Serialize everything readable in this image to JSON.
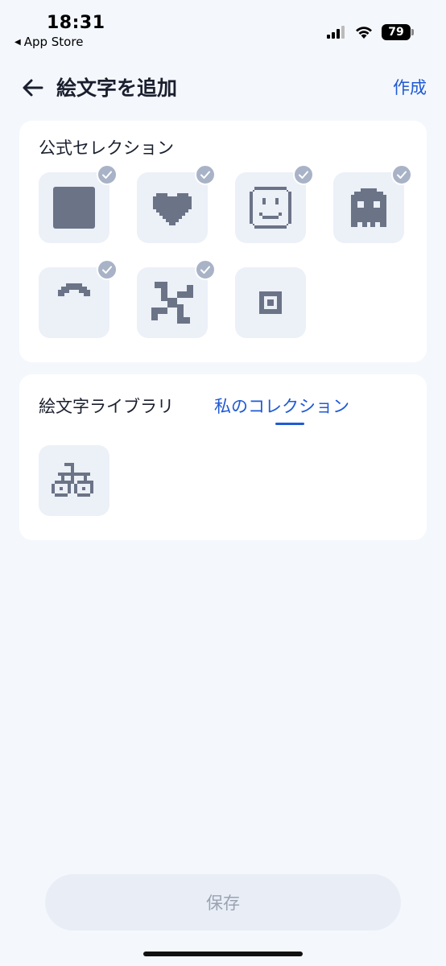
{
  "status_bar": {
    "time": "18:31",
    "back_app": "App Store",
    "battery": "79"
  },
  "header": {
    "title": "絵文字を追加",
    "create_label": "作成"
  },
  "official_selection": {
    "title": "公式セレクション",
    "items": [
      {
        "icon": "square-icon",
        "selected": true
      },
      {
        "icon": "heart-icon",
        "selected": true
      },
      {
        "icon": "smiley-face-icon",
        "selected": true
      },
      {
        "icon": "ghost-icon",
        "selected": true
      },
      {
        "icon": "arch-icon",
        "selected": true
      },
      {
        "icon": "pinwheel-icon",
        "selected": true
      },
      {
        "icon": "concentric-square-icon",
        "selected": false
      }
    ]
  },
  "library": {
    "tabs": [
      {
        "label": "絵文字ライブラリ",
        "active": false
      },
      {
        "label": "私のコレクション",
        "active": true
      }
    ],
    "items": [
      {
        "icon": "bicycle-icon"
      }
    ]
  },
  "footer": {
    "save_label": "保存"
  },
  "colors": {
    "accent": "#1f5ad6",
    "background": "#f4f7fc",
    "tile": "#ecf0f7",
    "glyph": "#6b7387",
    "check": "#a9b3c7"
  }
}
